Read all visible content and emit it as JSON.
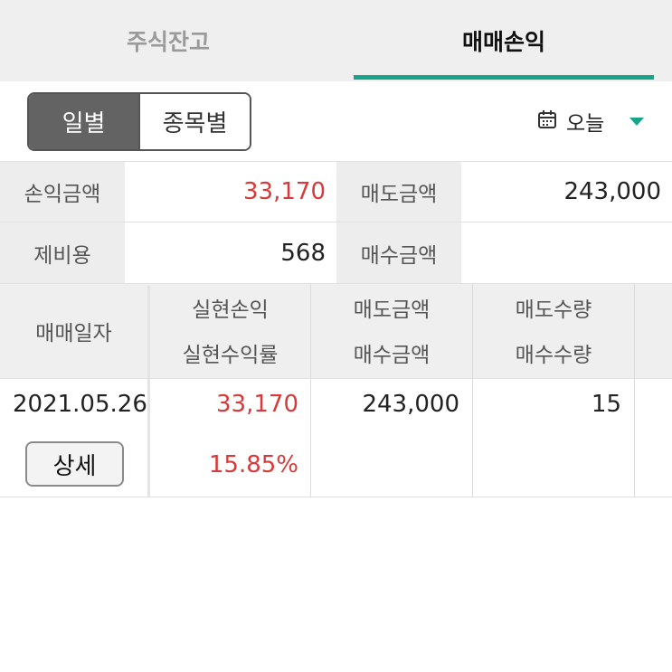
{
  "tabs": {
    "stock_balance": "주식잔고",
    "trade_pnl": "매매손익",
    "active_color": "#17a589"
  },
  "segment": {
    "daily": "일별",
    "by_stock": "종목별"
  },
  "date_filter": {
    "icon": "calendar-icon",
    "label": "오늘"
  },
  "summary": {
    "pnl_label": "손익금액",
    "pnl_value": "33,170",
    "sell_label": "매도금액",
    "sell_value": "243,000",
    "fee_label": "제비용",
    "fee_value": "568",
    "buy_label": "매수금액",
    "buy_value": ""
  },
  "table": {
    "headers": {
      "date": "매매일자",
      "realized_pnl": "실현손익",
      "realized_rate": "실현수익률",
      "sell_amount": "매도금액",
      "buy_amount": "매수금액",
      "sell_qty": "매도수량",
      "buy_qty": "매수수량"
    },
    "rows": [
      {
        "date": "2021.05.26",
        "detail_label": "상세",
        "realized_pnl": "33,170",
        "realized_rate": "15.85%",
        "sell_amount": "243,000",
        "buy_amount": "",
        "sell_qty": "15",
        "buy_qty": ""
      }
    ]
  },
  "colors": {
    "positive": "#d63a3a",
    "accent": "#17a589"
  }
}
